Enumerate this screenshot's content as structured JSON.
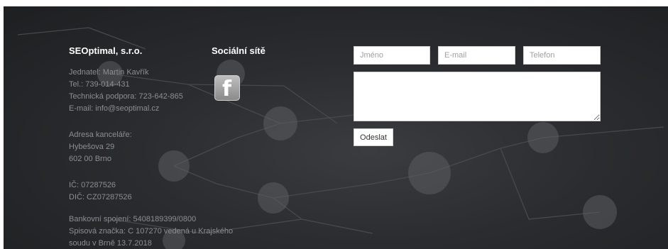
{
  "company": {
    "name": "SEOptimal, s.r.o.",
    "contact_lines": [
      "Jednatel: Martin Kavřík",
      "Tel.: 739-014-431",
      "Technická podpora: 723-642-865",
      "E-mail: info@seoptimal.cz"
    ],
    "address_lines": [
      "Adresa kanceláře:",
      "Hybešova 29",
      "602 00 Brno"
    ],
    "ids": [
      "IČ: 07287526",
      "DIČ: CZ07287526"
    ],
    "bank_lines": [
      "Bankovní spojení: 5408189399/0800",
      "Spisová značka: C 107270 vedená u Krajského",
      "soudu v Brně 13.7.2018"
    ]
  },
  "social": {
    "heading": "Sociální sítě",
    "links": [
      {
        "icon": "facebook-icon",
        "glyph": "f"
      }
    ]
  },
  "form": {
    "name_placeholder": "Jméno",
    "email_placeholder": "E-mail",
    "phone_placeholder": "Telefon",
    "message_placeholder": "",
    "submit_label": "Odeslat"
  }
}
